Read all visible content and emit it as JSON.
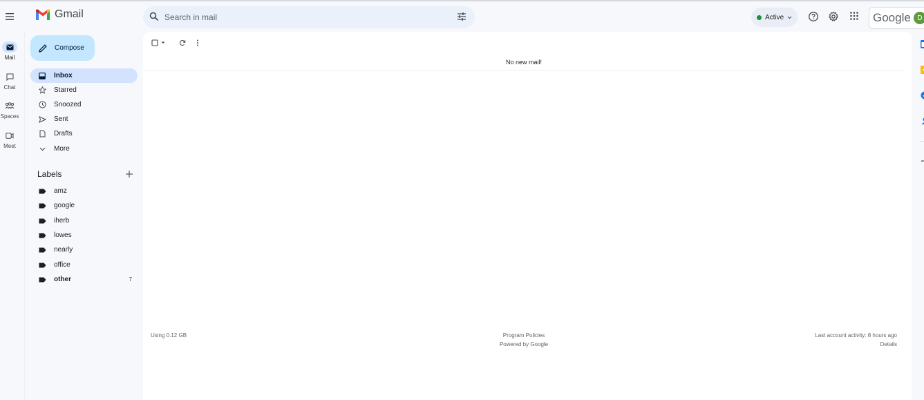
{
  "app": {
    "name": "Gmail",
    "brand_word": "Google",
    "account_initial": "D",
    "colors": {
      "compose_bg": "#c2e7ff",
      "active_nav_bg": "#d3e3fd",
      "search_bg": "#eaf1fb",
      "status_green": "#1e8e3e",
      "avatar_bg": "#5f9a3c"
    }
  },
  "header": {
    "search_placeholder": "Search in mail",
    "status_label": "Active",
    "icons": [
      "menu-icon",
      "search-icon",
      "tune-icon",
      "help-icon",
      "gear-icon",
      "apps-grid-icon"
    ]
  },
  "rail": [
    {
      "label": "Mail",
      "icon": "mail-icon",
      "active": true
    },
    {
      "label": "Chat",
      "icon": "chat-icon",
      "active": false
    },
    {
      "label": "Spaces",
      "icon": "spaces-icon",
      "active": false
    },
    {
      "label": "Meet",
      "icon": "meet-icon",
      "active": false
    }
  ],
  "compose": {
    "label": "Compose"
  },
  "nav": {
    "items": [
      {
        "label": "Inbox",
        "icon": "inbox-icon",
        "active": true
      },
      {
        "label": "Starred",
        "icon": "star-icon"
      },
      {
        "label": "Snoozed",
        "icon": "clock-icon"
      },
      {
        "label": "Sent",
        "icon": "send-icon"
      },
      {
        "label": "Drafts",
        "icon": "draft-icon"
      },
      {
        "label": "More",
        "icon": "chevron-down-icon"
      }
    ]
  },
  "labels": {
    "title": "Labels",
    "items": [
      {
        "label": "amz"
      },
      {
        "label": "google"
      },
      {
        "label": "iherb"
      },
      {
        "label": "lowes"
      },
      {
        "label": "nearly"
      },
      {
        "label": "office"
      },
      {
        "label": "other",
        "count": "7"
      }
    ]
  },
  "main": {
    "empty_message": "No new mail!",
    "footer": {
      "storage": "Using 0.12 GB",
      "policies": "Program Policies",
      "powered": "Powered by Google",
      "activity": "Last account activity: 8 hours ago",
      "details": "Details"
    }
  }
}
